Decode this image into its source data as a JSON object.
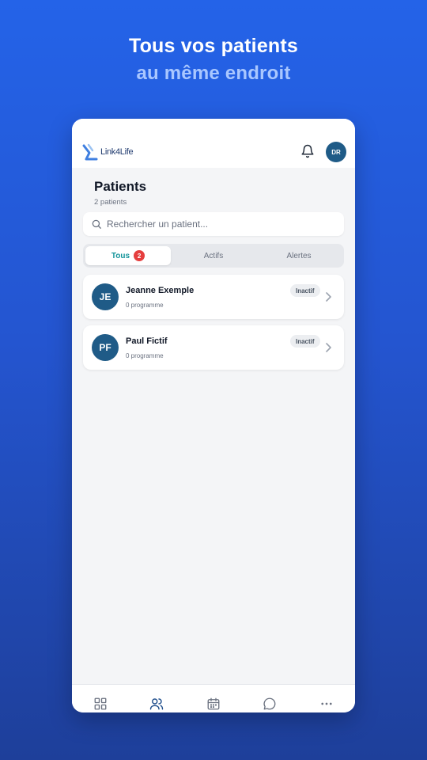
{
  "promo": {
    "line1": "Tous vos patients",
    "line2": "au même endroit"
  },
  "app": {
    "logo_text": "Link4Life",
    "user_initials": "DR",
    "bell_icon": "bell-icon"
  },
  "page": {
    "title": "Patients",
    "subtitle": "2 patients"
  },
  "search": {
    "placeholder": "Rechercher un patient..."
  },
  "tabs": [
    {
      "label": "Tous",
      "badge": "2",
      "active": true
    },
    {
      "label": "Actifs",
      "active": false
    },
    {
      "label": "Alertes",
      "active": false
    }
  ],
  "patients": [
    {
      "initials": "JE",
      "name": "Jeanne Exemple",
      "programs": "0 programme",
      "status": "Inactif"
    },
    {
      "initials": "PF",
      "name": "Paul Fictif",
      "programs": "0 programme",
      "status": "Inactif"
    }
  ],
  "bottom_nav": [
    {
      "icon": "dashboard-icon",
      "active": false
    },
    {
      "icon": "users-icon",
      "active": true
    },
    {
      "icon": "calendar-icon",
      "active": false
    },
    {
      "icon": "chat-icon",
      "active": false
    },
    {
      "icon": "more-icon",
      "active": false
    }
  ],
  "colors": {
    "accent_teal": "#13949a",
    "avatar_blue": "#1f5b87",
    "badge_red": "#e53e3e",
    "nav_active": "#1f4e8c"
  }
}
